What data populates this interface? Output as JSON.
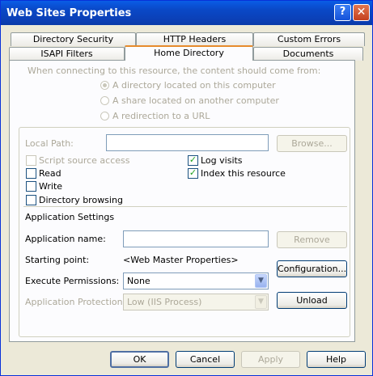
{
  "window": {
    "title": "Web Sites Properties",
    "help_glyph": "?",
    "close_glyph": "✕"
  },
  "tabs": {
    "row1": [
      "Directory Security",
      "HTTP Headers",
      "Custom Errors"
    ],
    "row2": [
      "ISAPI Filters",
      "Home Directory",
      "Documents"
    ],
    "active": "Home Directory"
  },
  "source": {
    "prompt": "When connecting to this resource, the content should come from:",
    "options": [
      "A directory located on this computer",
      "A share located on another computer",
      "A redirection to a URL"
    ],
    "selected_index": 0
  },
  "local_path": {
    "label": "Local Path:",
    "value": "",
    "browse_label": "Browse..."
  },
  "permissions": {
    "script_source_access": {
      "label": "Script source access",
      "checked": false,
      "enabled": false
    },
    "read": {
      "label": "Read",
      "checked": false
    },
    "write": {
      "label": "Write",
      "checked": false
    },
    "directory_browsing": {
      "label": "Directory browsing",
      "checked": false
    },
    "log_visits": {
      "label": "Log visits",
      "checked": true
    },
    "index_resource": {
      "label": "Index this resource",
      "checked": true
    },
    "check_glyph": "✓"
  },
  "app_settings": {
    "header": "Application Settings",
    "name_label": "Application name:",
    "name_value": "",
    "remove_label": "Remove",
    "starting_point_label": "Starting point:",
    "starting_point_value": "<Web Master Properties>",
    "configuration_label": "Configuration...",
    "execute_label": "Execute Permissions:",
    "execute_value": "None",
    "protection_label": "Application Protection:",
    "protection_value": "Low (IIS Process)",
    "unload_label": "Unload",
    "dropdown_glyph": "▼"
  },
  "footer": {
    "ok": "OK",
    "cancel": "Cancel",
    "apply": "Apply",
    "help": "Help"
  }
}
